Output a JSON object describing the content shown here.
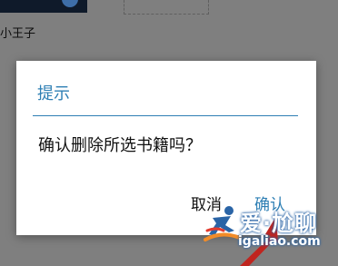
{
  "background": {
    "book_title": "小王子"
  },
  "dialog": {
    "title": "提示",
    "message": "确认删除所选书籍吗？",
    "cancel_label": "取消",
    "confirm_label": "确认",
    "accent_color": "#2e7fb4"
  },
  "annotation": {
    "arrow_color": "#c0251f",
    "arrow_icon": "red-pointer-arrow-icon"
  },
  "watermark": {
    "brand": "爱·尬聊",
    "site": "igaliao.com",
    "logo_icon": "runner-logo-icon"
  }
}
